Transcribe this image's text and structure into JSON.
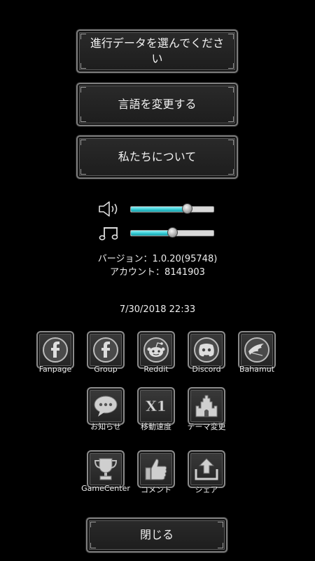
{
  "menu": {
    "select_save": "進行データを選んでください",
    "language": "言語を変更する",
    "about": "私たちについて"
  },
  "audio": {
    "sound_icon": "speaker-icon",
    "music_icon": "music-note-icon",
    "sound_level": 0.68,
    "music_level": 0.5
  },
  "info": {
    "version": "バージョン：1.0.20(95748)",
    "account": "アカウント：8141903",
    "datetime": "7/30/2018 22:33"
  },
  "links": [
    {
      "label": "Fanpage",
      "icon": "facebook-icon"
    },
    {
      "label": "Group",
      "icon": "facebook-group-icon"
    },
    {
      "label": "Reddit",
      "icon": "reddit-icon"
    },
    {
      "label": "Discord",
      "icon": "discord-icon"
    },
    {
      "label": "Bahamut",
      "icon": "bahamut-icon"
    },
    {
      "label": "お知らせ",
      "icon": "speech-bubble-icon"
    },
    {
      "label": "移動速度",
      "icon": "speed-x1-icon"
    },
    {
      "label": "テーマ変更",
      "icon": "castle-icon"
    },
    {
      "label": "GameCenter",
      "icon": "trophy-icon"
    },
    {
      "label": "コメント",
      "icon": "thumbs-up-icon"
    },
    {
      "label": "シェア",
      "icon": "share-icon"
    }
  ],
  "close_label": "閉じる",
  "colors": {
    "slider_fill": "#2bc5cf",
    "button_border": "#8a8a8a",
    "background": "#000000"
  }
}
